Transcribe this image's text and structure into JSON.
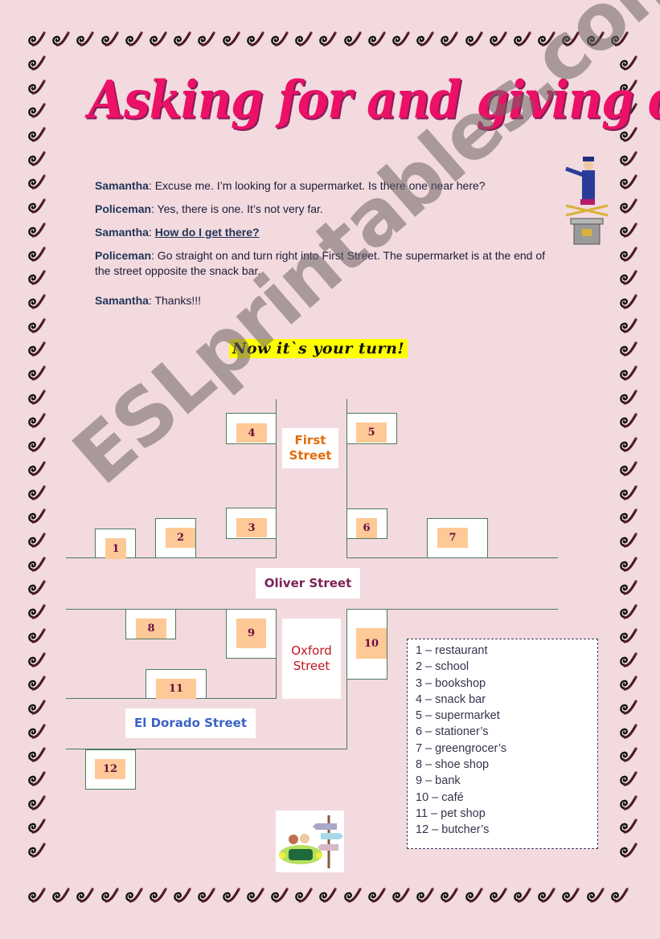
{
  "title": "Asking for and giving directions",
  "dialogue": [
    {
      "speaker": "Samantha",
      "text": ": Excuse me. I’m looking for a supermarket. Is there one near here?"
    },
    {
      "speaker": "Policeman",
      "text": ": Yes, there is one. It’s not very far."
    },
    {
      "speaker": "Samantha",
      "text": ": ",
      "underlined": "How do I get there?"
    },
    {
      "speaker": "Policeman",
      "text": ": Go straight on and turn right into First Street. The supermarket is at the end of the street opposite the snack bar."
    },
    {
      "speaker": "Samantha",
      "text": ": Thanks!!!"
    }
  ],
  "banner": "Now it`s your turn!",
  "streets": {
    "first": "First Street",
    "oliver": "Oliver Street",
    "oxford": "Oxford Street",
    "eldorado": "El Dorado Street"
  },
  "street_colors": {
    "first": "#e36c0a",
    "oliver": "#7b2256",
    "oxford": "#c0151f",
    "eldorado": "#3b63c4"
  },
  "buildings": [
    "1",
    "2",
    "3",
    "4",
    "5",
    "6",
    "7",
    "8",
    "9",
    "10",
    "11",
    "12"
  ],
  "legend": [
    "1 – restaurant",
    "2 – school",
    "3 – bookshop",
    "4 – snack bar",
    "5 – supermarket",
    "6 – stationer’s",
    "7 – greengrocer’s",
    "8 – shoe shop",
    "9 – bank",
    "10 – café",
    "11 – pet shop",
    "12 – butcher’s"
  ],
  "watermark": "ESLprintables.com",
  "icons": {
    "border": "swirl-pen-icon",
    "policeman": "policeman-pointing-icon",
    "car": "car-signpost-icon"
  },
  "colors": {
    "background": "#f2dade",
    "title": "#ec1067",
    "banner": "#ffff00",
    "number_tile": "#fdc996"
  }
}
